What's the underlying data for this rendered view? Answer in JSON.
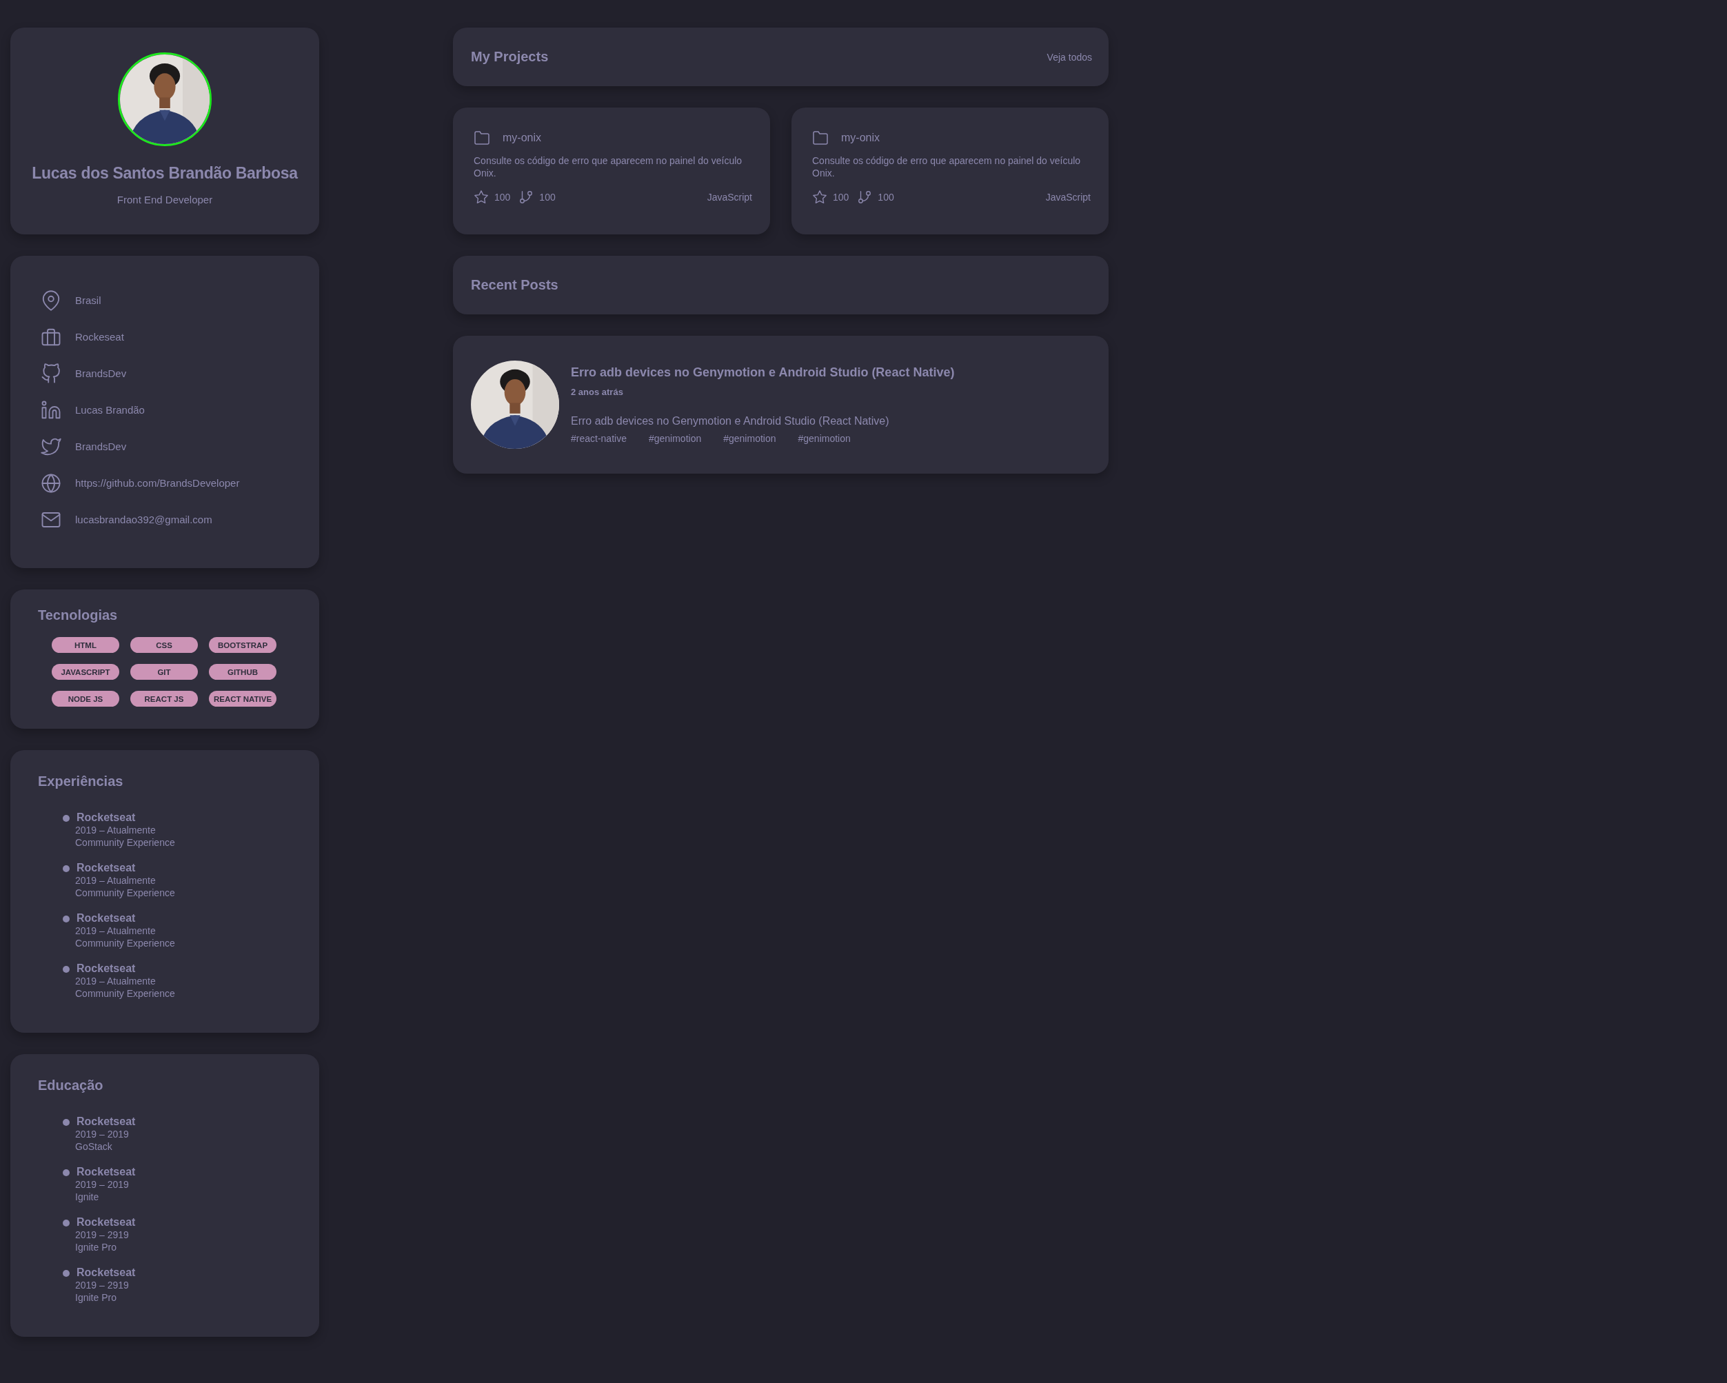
{
  "profile": {
    "name": "Lucas dos Santos Brandão Barbosa",
    "role": "Front End Developer"
  },
  "info": [
    {
      "kind": "location",
      "text": "Brasil"
    },
    {
      "kind": "company",
      "text": "Rockeseat"
    },
    {
      "kind": "github",
      "text": "BrandsDev"
    },
    {
      "kind": "linkedin",
      "text": "Lucas Brandão"
    },
    {
      "kind": "twitter",
      "text": "BrandsDev"
    },
    {
      "kind": "website",
      "text": "https://github.com/BrandsDeveloper"
    },
    {
      "kind": "email",
      "text": "lucasbrandao392@gmail.com"
    }
  ],
  "technologies": {
    "title": "Tecnologias",
    "tags": [
      "HTML",
      "CSS",
      "BOOTSTRAP",
      "JAVASCRIPT",
      "GIT",
      "GITHUB",
      "NODE JS",
      "REACT JS",
      "REACT NATIVE"
    ]
  },
  "experiences": {
    "title": "Experiências",
    "items": [
      {
        "company": "Rocketseat",
        "period": "2019 – Atualmente",
        "role": "Community Experience"
      },
      {
        "company": "Rocketseat",
        "period": "2019 – Atualmente",
        "role": "Community Experience"
      },
      {
        "company": "Rocketseat",
        "period": "2019 – Atualmente",
        "role": "Community Experience"
      },
      {
        "company": "Rocketseat",
        "period": "2019 – Atualmente",
        "role": "Community Experience"
      }
    ]
  },
  "education": {
    "title": "Educação",
    "items": [
      {
        "company": "Rocketseat",
        "period": "2019 – 2019",
        "role": "GoStack"
      },
      {
        "company": "Rocketseat",
        "period": "2019 – 2019",
        "role": "Ignite"
      },
      {
        "company": "Rocketseat",
        "period": "2019 – 2919",
        "role": "Ignite Pro"
      },
      {
        "company": "Rocketseat",
        "period": "2019 – 2919",
        "role": "Ignite Pro"
      }
    ]
  },
  "projects": {
    "title": "My Projects",
    "link": "Veja todos",
    "items": [
      {
        "name": "my-onix",
        "description": "Consulte os código de erro que aparecem no painel do veículo Onix.",
        "stars": "100",
        "forks": "100",
        "language": "JavaScript"
      },
      {
        "name": "my-onix",
        "description": "Consulte os código de erro que aparecem no painel do veículo Onix.",
        "stars": "100",
        "forks": "100",
        "language": "JavaScript"
      }
    ]
  },
  "posts": {
    "title": "Recent Posts",
    "items": [
      {
        "title": "Erro adb devices no Genymotion e Android Studio (React Native)",
        "time": "2 anos atrás",
        "summary": "Erro adb devices no Genymotion e Android Studio (React Native)",
        "tags": [
          "#react-native",
          "#genimotion",
          "#genimotion",
          "#genimotion"
        ]
      }
    ]
  }
}
